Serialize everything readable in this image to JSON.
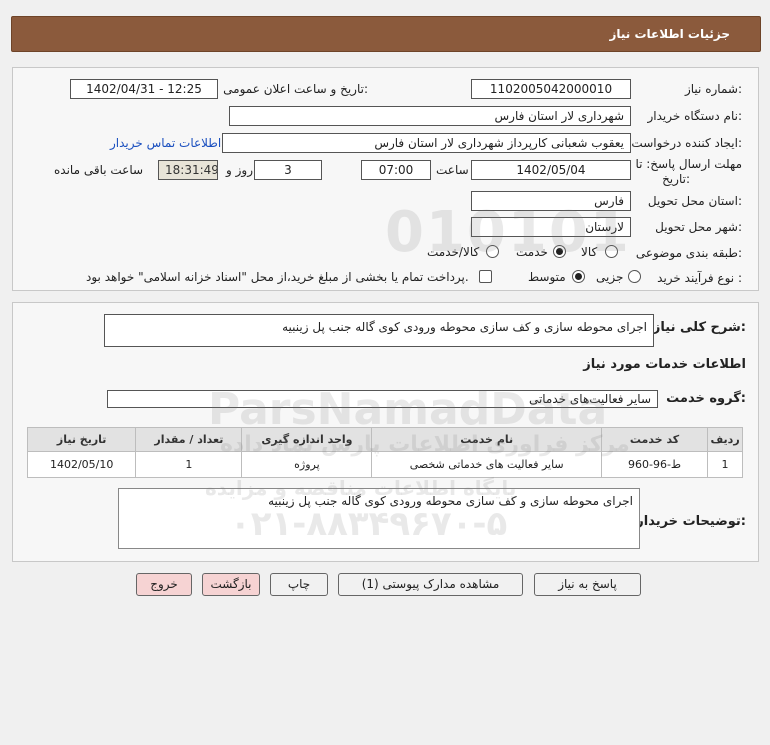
{
  "header": {
    "title": "جزئیات اطلاعات نیاز"
  },
  "form": {
    "need_number": {
      "label": "شماره نیاز:",
      "value": "1102005042000010"
    },
    "announce": {
      "label": "تاریخ و ساعت اعلان عمومی:",
      "value": "1402/04/31 - 12:25"
    },
    "buyer_org": {
      "label": "نام دستگاه خریدار:",
      "value": "شهرداری لار استان فارس"
    },
    "creator": {
      "label": "ایجاد کننده درخواست:",
      "value": "یعقوب شعبانی کارپرداز شهرداری لار استان فارس"
    },
    "contact_link": "اطلاعات تماس خریدار",
    "deadline": {
      "label_line1": "مهلت ارسال پاسخ: تا",
      "label_line2": "تاریخ:",
      "date": "1402/05/04",
      "time_label": "ساعت",
      "time": "07:00",
      "days": "3",
      "days_label": "روز و",
      "remaining": "18:31:49",
      "remaining_label": "ساعت باقی مانده"
    },
    "province": {
      "label": "استان محل تحویل:",
      "value": "فارس"
    },
    "city": {
      "label": "شهر محل تحویل:",
      "value": "لارستان"
    },
    "category": {
      "label": "طبقه بندی موضوعی:",
      "options": [
        "کالا",
        "خدمت",
        "کالا/خدمت"
      ],
      "selected": "خدمت"
    },
    "process": {
      "label": "نوع فرآیند خرید :",
      "options": [
        "جزیی",
        "متوسط"
      ],
      "selected": "متوسط",
      "checkbox_text": "پرداخت تمام یا بخشی از مبلغ خرید،از محل \"اسناد خزانه اسلامی\" خواهد بود."
    }
  },
  "details": {
    "summary_label": "شرح کلی نیاز:",
    "summary": "اجرای محوطه سازی و کف سازی محوطه ورودی کوی گاله جنب پل زینبیه",
    "services_title": "اطلاعات خدمات مورد نیاز",
    "group_label": "گروه خدمت:",
    "group_value": "سایر فعالیت‌های خدماتی",
    "table": {
      "headers": [
        "ردیف",
        "کد خدمت",
        "نام خدمت",
        "واحد اندازه گیری",
        "تعداد / مقدار",
        "تاریخ نیاز"
      ],
      "rows": [
        [
          "1",
          "ط-96-960",
          "سایر فعالیت های خدماتی شخصی",
          "پروژه",
          "1",
          "1402/05/10"
        ]
      ]
    },
    "buyer_notes_label": "توضیحات خریدار:",
    "buyer_notes": "اجرای محوطه سازی و کف سازی محوطه ورودی کوی گاله جنب پل زینبیه"
  },
  "buttons": {
    "reply": "پاسخ به نیاز",
    "attachments": "مشاهده مدارک پیوستی (1)",
    "print": "چاپ",
    "back": "بازگشت",
    "exit": "خروج"
  },
  "watermark": {
    "brand": "ParsNamadData",
    "line1": "مرکز فراوری اطلاعات پارس نماد داده",
    "line2": "پایگاه اطلاعات مناقصه و مزایده",
    "phone": "۰۲۱-۸۸۳۴۹۶۷۰-۵"
  },
  "colors": {
    "header_bg": "#8b5a3c",
    "link": "#1a4fbf",
    "pink_button": "#f6d3d3"
  }
}
